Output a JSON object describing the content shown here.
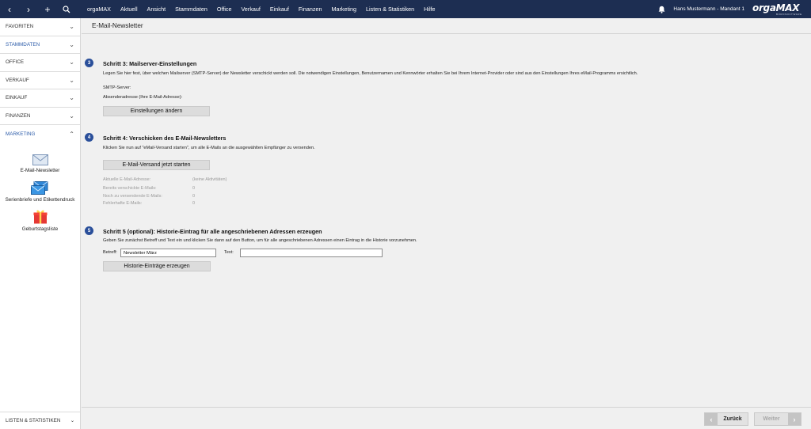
{
  "topbar": {
    "nav": {
      "back_glyph": "‹",
      "forward_glyph": "›",
      "add_glyph": "+",
      "search_icon": "search-icon"
    },
    "menu": [
      "orgaMAX",
      "Aktuell",
      "Ansicht",
      "Stammdaten",
      "Office",
      "Verkauf",
      "Einkauf",
      "Finanzen",
      "Marketing",
      "Listen & Statistiken",
      "Hilfe"
    ],
    "user": "Hans Mustermann - Mandant 1",
    "logo": {
      "main": "orgaMAX",
      "sub": "BÜROSOFTWARE"
    }
  },
  "sidebar": {
    "sections": [
      {
        "label": "FAVORITEN",
        "chevron": "⌄"
      },
      {
        "label": "STAMMDATEN",
        "chevron": "⌄"
      },
      {
        "label": "OFFICE",
        "chevron": "⌄"
      },
      {
        "label": "VERKAUF",
        "chevron": "⌄"
      },
      {
        "label": "EINKAUF",
        "chevron": "⌄"
      },
      {
        "label": "FINANZEN",
        "chevron": "⌄"
      },
      {
        "label": "MARKETING",
        "chevron": "⌃"
      }
    ],
    "tools": [
      {
        "label": "E-Mail-Newsletter",
        "icon": "envelope-icon"
      },
      {
        "label": "Serienbriefe und Etikettendruck",
        "icon": "envelopes-icon"
      },
      {
        "label": "Geburtstagsliste",
        "icon": "gift-icon"
      }
    ],
    "bottom": {
      "label": "LISTEN & STATISTIKEN",
      "chevron": "⌄"
    }
  },
  "page": {
    "title": "E-Mail-Newsletter",
    "step3": {
      "num": "3",
      "title": "Schritt 3: Mailserver-Einstellungen",
      "desc": "Legen Sie hier fest, über welchen Mailserver (SMTP-Server) der Newsletter verschickt werden soll. Die notwendigen Einstellungen, Benutzernamen und Kennwörter erhalten Sie bei Ihrem Internet-Provider oder sind aus den Einstellungen Ihres eMail-Programms ersichtlich.",
      "smtp_label": "SMTP-Server:",
      "sender_label": "Absenderadresse (Ihre E-Mail-Adresse):",
      "button": "Einstellungen ändern"
    },
    "step4": {
      "num": "4",
      "title": "Schritt 4: Verschicken des E-Mail-Newsletters",
      "desc": "Klicken Sie nun auf \"eMail-Versand starten\", um alle E-Mails an die ausgewählten Empfänger zu versenden.",
      "button": "E-Mail-Versand jetzt starten",
      "stats": [
        {
          "label": "Aktuelle E-Mail-Adresse:",
          "value": "(keine Aktivitäten)"
        },
        {
          "label": "Bereits verschickte E-Mails:",
          "value": "0"
        },
        {
          "label": "Noch zu versendende E-Mails:",
          "value": "0"
        },
        {
          "label": "Fehlerhafte E-Mails:",
          "value": "0"
        }
      ]
    },
    "step5": {
      "num": "5",
      "title": "Schritt 5 (optional): Historie-Eintrag für alle angeschriebenen Adressen erzeugen",
      "desc": "Geben Sie zunächst Betreff und Text ein und klicken Sie dann auf den Button, um für alle angeschriebenen Adressen einen Eintrag in die Historie vorzunehmen.",
      "subject_label": "Betreff:",
      "subject_value": "Newsletter März",
      "text_label": "Text:",
      "text_value": "",
      "button": "Historie-Einträge erzeugen"
    }
  },
  "footer": {
    "back": "Zurück",
    "next": "Weiter",
    "back_glyph": "‹",
    "next_glyph": "›"
  },
  "colors": {
    "topbar": "#1d2e52",
    "accent": "#2a4f9a",
    "sidebar_active": "#2a5aa8"
  }
}
